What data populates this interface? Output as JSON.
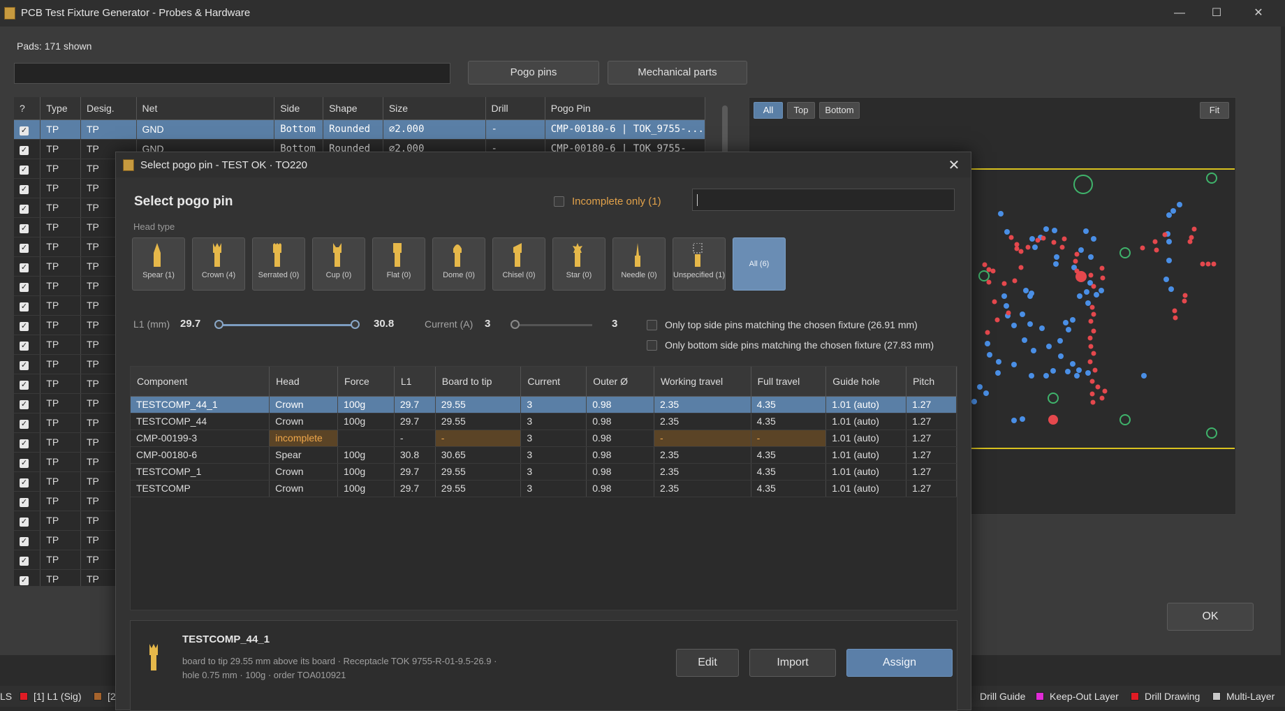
{
  "window": {
    "title": "PCB Test Fixture Generator - Probes & Hardware",
    "minimize_glyph": "—",
    "maximize_glyph": "☐",
    "close_glyph": "✕"
  },
  "pads": {
    "count_label": "Pads: 171 shown",
    "filter_value": ""
  },
  "toolbar": {
    "pogo_label": "Pogo pins",
    "mech_label": "Mechanical parts"
  },
  "pad_table": {
    "headers": [
      "?",
      "Type",
      "Desig.",
      "Net",
      "Side",
      "Shape",
      "Size",
      "Drill",
      "Pogo Pin"
    ],
    "rows": [
      [
        "TP",
        "TP",
        "GND",
        "Bottom",
        "Rounded",
        "∅2.000",
        "-",
        "CMP-00180-6 | TOK_9755-..."
      ],
      [
        "TP",
        "TP",
        "GND",
        "Bottom",
        "Rounded",
        "∅2.000",
        "-",
        "CMP-00180-6 | TOK_9755-"
      ],
      [
        "TP",
        "TP",
        "",
        "",
        "",
        "",
        "",
        ""
      ],
      [
        "TP",
        "TP",
        "",
        "",
        "",
        "",
        "",
        ""
      ],
      [
        "TP",
        "TP",
        "",
        "",
        "",
        "",
        "",
        ""
      ],
      [
        "TP",
        "TP",
        "",
        "",
        "",
        "",
        "",
        ""
      ],
      [
        "TP",
        "TP",
        "",
        "",
        "",
        "",
        "",
        ""
      ],
      [
        "TP",
        "TP",
        "",
        "",
        "",
        "",
        "",
        ""
      ],
      [
        "TP",
        "TP",
        "",
        "",
        "",
        "",
        "",
        ""
      ],
      [
        "TP",
        "TP",
        "",
        "",
        "",
        "",
        "",
        ""
      ],
      [
        "TP",
        "TP",
        "",
        "",
        "",
        "",
        "",
        ""
      ],
      [
        "TP",
        "TP",
        "",
        "",
        "",
        "",
        "",
        ""
      ],
      [
        "TP",
        "TP",
        "",
        "",
        "",
        "",
        "",
        ""
      ],
      [
        "TP",
        "TP",
        "",
        "",
        "",
        "",
        "",
        ""
      ],
      [
        "TP",
        "TP",
        "",
        "",
        "",
        "",
        "",
        ""
      ],
      [
        "TP",
        "TP",
        "",
        "",
        "",
        "",
        "",
        ""
      ],
      [
        "TP",
        "TP",
        "",
        "",
        "",
        "",
        "",
        ""
      ],
      [
        "TP",
        "TP",
        "",
        "",
        "",
        "",
        "",
        ""
      ],
      [
        "TP",
        "TP",
        "",
        "",
        "",
        "",
        "",
        ""
      ],
      [
        "TP",
        "TP",
        "",
        "",
        "",
        "",
        "",
        ""
      ],
      [
        "TP",
        "TP",
        "",
        "",
        "",
        "",
        "",
        ""
      ],
      [
        "TP",
        "TP",
        "",
        "",
        "",
        "",
        "",
        ""
      ],
      [
        "TP",
        "TP",
        "",
        "",
        "",
        "",
        "",
        ""
      ],
      [
        "TP",
        "TP",
        "",
        "",
        "",
        "",
        "",
        ""
      ]
    ]
  },
  "preview": {
    "side_all": "All",
    "side_top": "Top",
    "side_bottom": "Bottom",
    "fit_label": "Fit",
    "outline_color": "#d9c21f",
    "pad_red": "#e5484d",
    "pad_blue": "#4a8fe6",
    "hole_green": "#3fb36b"
  },
  "ok_label": "OK",
  "status_layers": [
    {
      "label": "LS",
      "color": ""
    },
    {
      "label": "[1] L1 (Sig)",
      "color": "#e01b24"
    },
    {
      "label": "[2",
      "color": "#a8652e"
    },
    {
      "label": "Drill Guide",
      "color": ""
    },
    {
      "label": "Keep-Out Layer",
      "color": "#e02bd6"
    },
    {
      "label": "Drill Drawing",
      "color": "#e01b24"
    },
    {
      "label": "Multi-Layer",
      "color": "#c8c8c8"
    }
  ],
  "dialog": {
    "title": "Select pogo pin  -  TEST OK · TO220",
    "close_glyph": "✕",
    "heading": "Select pogo pin",
    "incomplete_only_label": "Incomplete only (1)",
    "search_value": "",
    "head_type_label": "Head type",
    "head_types": [
      {
        "label": "Spear (1)",
        "icon": "spear-icon"
      },
      {
        "label": "Crown (4)",
        "icon": "crown-icon"
      },
      {
        "label": "Serrated (0)",
        "icon": "serrated-icon"
      },
      {
        "label": "Cup (0)",
        "icon": "cup-icon"
      },
      {
        "label": "Flat (0)",
        "icon": "flat-icon"
      },
      {
        "label": "Dome (0)",
        "icon": "dome-icon"
      },
      {
        "label": "Chisel (0)",
        "icon": "chisel-icon"
      },
      {
        "label": "Star (0)",
        "icon": "star-icon"
      },
      {
        "label": "Needle (0)",
        "icon": "needle-icon"
      },
      {
        "label": "Unspecified (1)",
        "icon": "unspecified-icon"
      },
      {
        "label": "All (6)",
        "icon": ""
      }
    ],
    "filters": {
      "l1_label": "L1 (mm)",
      "l1_min": "29.7",
      "l1_max": "30.8",
      "current_label": "Current (A)",
      "current_min": "3",
      "current_max": "3",
      "top_only_label": "Only top side pins matching the chosen fixture (26.91 mm)",
      "bottom_only_label": "Only bottom side pins matching the chosen fixture (27.83 mm)"
    },
    "pin_table": {
      "headers": [
        "Component",
        "Head",
        "Force",
        "L1",
        "Board to tip",
        "Current",
        "Outer Ø",
        "Working travel",
        "Full travel",
        "Guide hole",
        "Pitch"
      ],
      "rows": [
        [
          "TESTCOMP_44_1",
          "Crown",
          "100g",
          "29.7",
          "29.55",
          "3",
          "0.98",
          "2.35",
          "4.35",
          "1.01  (auto)",
          "1.27"
        ],
        [
          "TESTCOMP_44",
          "Crown",
          "100g",
          "29.7",
          "29.55",
          "3",
          "0.98",
          "2.35",
          "4.35",
          "1.01  (auto)",
          "1.27"
        ],
        [
          "CMP-00199-3",
          "incomplete",
          "",
          "-",
          "-",
          "3",
          "0.98",
          "-",
          "-",
          "1.01  (auto)",
          "1.27"
        ],
        [
          "CMP-00180-6",
          "Spear",
          "100g",
          "30.8",
          "30.65",
          "3",
          "0.98",
          "2.35",
          "4.35",
          "1.01  (auto)",
          "1.27"
        ],
        [
          "TESTCOMP_1",
          "Crown",
          "100g",
          "29.7",
          "29.55",
          "3",
          "0.98",
          "2.35",
          "4.35",
          "1.01  (auto)",
          "1.27"
        ],
        [
          "TESTCOMP",
          "Crown",
          "100g",
          "29.7",
          "29.55",
          "3",
          "0.98",
          "2.35",
          "4.35",
          "1.01  (auto)",
          "1.27"
        ]
      ]
    },
    "details": {
      "name": "TESTCOMP_44_1",
      "line1": "board to tip 29.55 mm above its board  ·  Receptacle TOK 9755-R-01-9.5-26.9  ·",
      "line2": "hole 0.75 mm  ·  100g  ·  order TOA010921",
      "edit_label": "Edit",
      "import_label": "Import",
      "assign_label": "Assign"
    }
  }
}
